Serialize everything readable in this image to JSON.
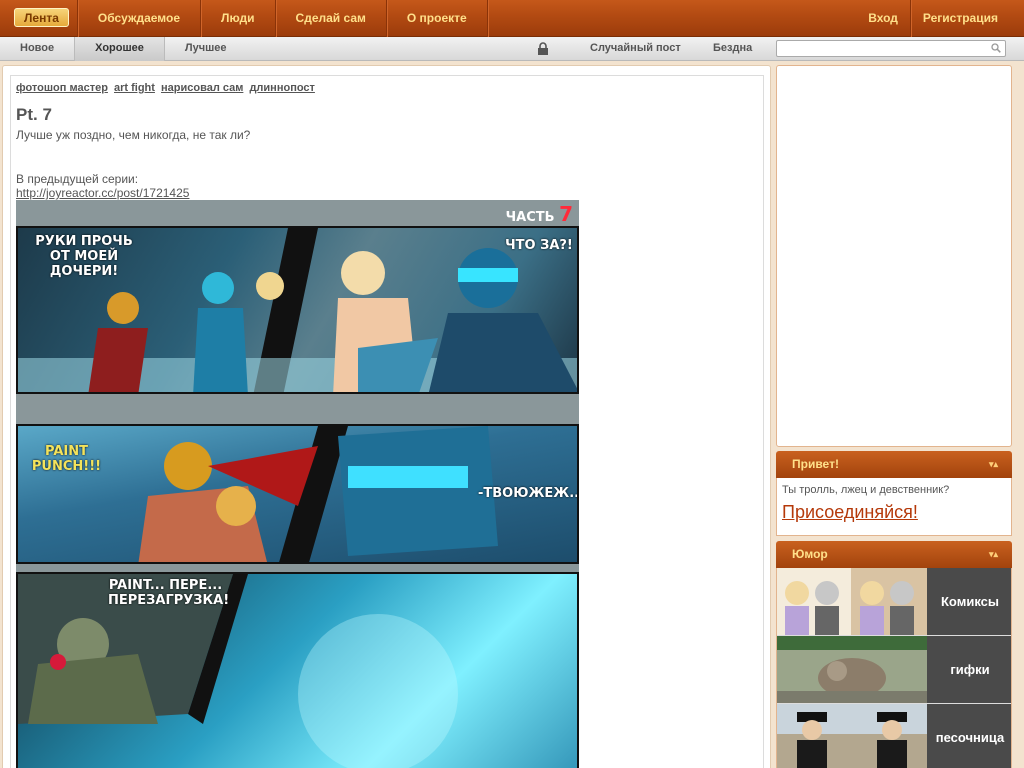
{
  "topnav": {
    "items": [
      "Лента",
      "Обсуждаемое",
      "Люди",
      "Сделай сам",
      "О проекте"
    ],
    "login": "Вход",
    "register": "Регистрация"
  },
  "subnav": {
    "tabs": [
      "Новое",
      "Хорошее",
      "Лучшее"
    ],
    "active_tab": "Хорошее",
    "random_post": "Случайный пост",
    "abyss": "Бездна",
    "search_placeholder": ""
  },
  "post": {
    "tags": [
      "фотошоп мастер",
      "art fight",
      "нарисовал сам",
      "длиннопост"
    ],
    "title": "Pt. 7",
    "subtitle": "Лучше уж поздно, чем никогда, не так ли?",
    "prev_label": "В предыдущей серии:",
    "prev_link": "http://joyreactor.cc/post/1721425",
    "comic": {
      "part_label": "ЧАСТЬ",
      "part_num": "7",
      "bubble1": "РУКИ ПРОЧЬ ОТ МОЕЙ ДОЧЕРИ!",
      "bubble2": "ЧТО ЗА?!",
      "bubble3": "PAINT PUNCH!!!",
      "bubble4": "-ТВОЮЖЕЖ...",
      "bubble5": "PAINT... ПЕРЕ... ПЕРЕЗАГРУЗКА!"
    }
  },
  "sidebar": {
    "hello": {
      "title": "Привет!",
      "message": "Ты тролль, лжец и девственник?",
      "join": "Присоединяйся!"
    },
    "humor": {
      "title": "Юмор",
      "items": [
        "Комиксы",
        "гифки",
        "песочница"
      ]
    }
  },
  "colors": {
    "accent": "#b24a12",
    "nav_text": "#ffe08a",
    "link_red": "#b5390a"
  }
}
